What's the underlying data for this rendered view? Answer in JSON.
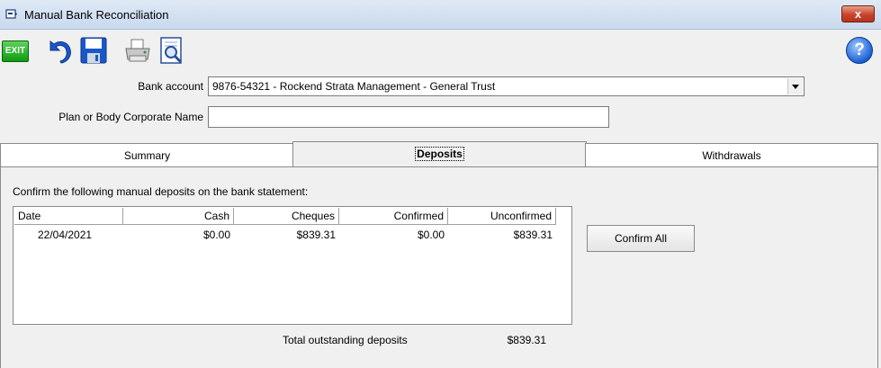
{
  "window": {
    "title": "Manual Bank Reconciliation",
    "close_label": "x"
  },
  "toolbar": {
    "exit_label": "EXIT",
    "icons": [
      "undo-icon",
      "save-icon",
      "print-icon",
      "print-preview-icon"
    ],
    "help_label": "?"
  },
  "form": {
    "bank_account_label": "Bank account",
    "bank_account_value": "9876-54321 - Rockend Strata Management - General Trust",
    "plan_label": "Plan or Body Corporate Name",
    "plan_value": ""
  },
  "tabs": [
    {
      "label": "Summary",
      "active": false
    },
    {
      "label": "Deposits",
      "active": true
    },
    {
      "label": "Withdrawals",
      "active": false
    }
  ],
  "deposits": {
    "instruction": "Confirm the following manual deposits on the bank statement:",
    "columns": [
      "Date",
      "Cash",
      "Cheques",
      "Confirmed",
      "Unconfirmed"
    ],
    "rows": [
      {
        "date": "22/04/2021",
        "cash": "$0.00",
        "cheques": "$839.31",
        "confirmed": "$0.00",
        "unconfirmed": "$839.31"
      }
    ],
    "confirm_all_label": "Confirm All",
    "total_label": "Total outstanding deposits",
    "total_value": "$839.31"
  }
}
